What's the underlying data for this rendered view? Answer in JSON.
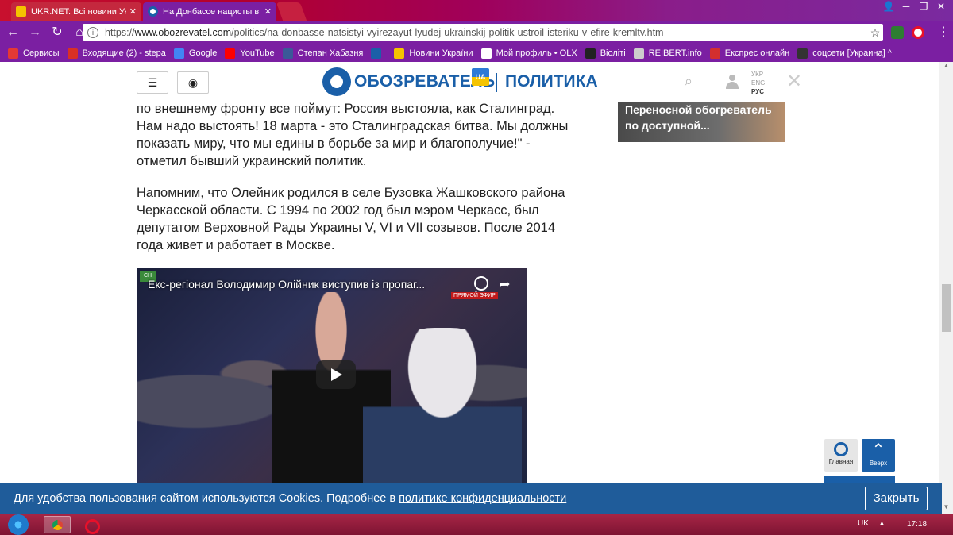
{
  "browser": {
    "tabs": [
      {
        "title": "UKR.NET: Всі новини Ук",
        "close": "✕"
      },
      {
        "title": "На Донбассе нацисты в",
        "close": "✕"
      }
    ],
    "window_controls": [
      "👤",
      "─",
      "❐",
      "✕"
    ],
    "url_scheme": "https://",
    "url_host": "www.obozrevatel.com",
    "url_path": "/politics/na-donbasse-natsistyi-vyirezayut-lyudej-ukrainskij-politik-ustroil-isteriku-v-efire-kremltv.htm",
    "bookmarks": [
      {
        "label": "Сервисы",
        "color": "#e53935"
      },
      {
        "label": "Входящие (2) - stepa",
        "color": "#d93025"
      },
      {
        "label": "Google",
        "color": "#4285f4"
      },
      {
        "label": "YouTube",
        "color": "#ff0000"
      },
      {
        "label": "Степан Хабазня",
        "color": "#3b5998"
      },
      {
        "label": "",
        "color": "#1a5fa8"
      },
      {
        "label": "Новини України",
        "color": "#f5c400"
      },
      {
        "label": "Мой профиль • OLX",
        "color": "#ffffff"
      },
      {
        "label": "Віоліті",
        "color": "#222222"
      },
      {
        "label": "REIBERT.info",
        "color": "#cccccc"
      },
      {
        "label": "Експрес онлайн",
        "color": "#d32f2f"
      },
      {
        "label": "соцсети [Украина] ^",
        "color": "#333333"
      }
    ]
  },
  "site": {
    "logo_text": "ОБОЗРЕВАТЕЛЬ",
    "logo_badge": "UA",
    "section": "ПОЛИТИКА",
    "langs": [
      "УКР",
      "ENG",
      "РУС"
    ]
  },
  "article": {
    "paragraphs": [
      "по внешнему фронту все поймут: Россия выстояла, как Сталинград. Нам надо выстоять! 18 марта - это Сталинградская битва. Мы должны показать миру, что мы едины в борьбе за мир и благополучие!\" - отметил бывший украинский политик.",
      "Напомним, что Олейник родился в селе Бузовка Жашковского района Черкасской области. С 1994 по 2002 год был мэром Черкасс, был депутатом Верховной Рады Украины V, VI и VII созывов. После 2014 года живет и работает в Москве."
    ],
    "video_title": "Екс-регіонал Володимир Олійник виступив із пропаг...",
    "video_live": "ПРЯМОЙ ЭФИР"
  },
  "sidebar": {
    "promo_text": "Переносной обогреватель по доступной...",
    "home_label": "Главная",
    "top_label": "Вверх"
  },
  "cookie": {
    "text": "Для удобства пользования сайтом используются Cookies. Подробнее в",
    "link": "политике конфиденциальности",
    "button": "Закрыть"
  },
  "taskbar": {
    "lang": "UK",
    "time": "17:18"
  }
}
